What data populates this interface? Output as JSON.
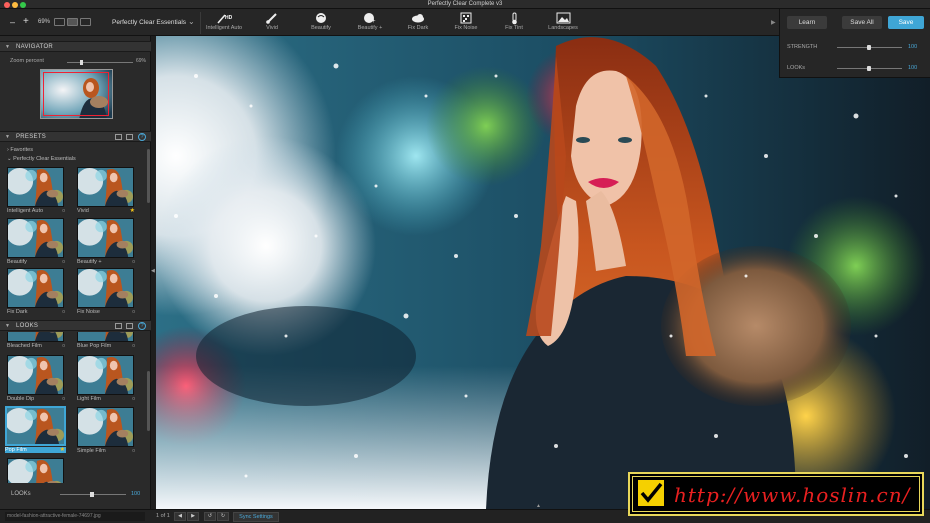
{
  "window": {
    "title": "Perfectly Clear Complete v3"
  },
  "toolbar": {
    "zoom_minus": "–",
    "zoom_plus": "+",
    "zoom_level": "69%",
    "preset_select": "Perfectly Clear Essentials",
    "tools": [
      {
        "label": "Intelligent Auto",
        "icon": "hd-wand-icon"
      },
      {
        "label": "Vivid",
        "icon": "brush-icon"
      },
      {
        "label": "Beautify",
        "icon": "face-icon"
      },
      {
        "label": "Beautify +",
        "icon": "face-plus-icon"
      },
      {
        "label": "Fix Dark",
        "icon": "cloud-icon"
      },
      {
        "label": "Fix Noise",
        "icon": "noise-icon"
      },
      {
        "label": "Fix Tint",
        "icon": "thermometer-icon"
      },
      {
        "label": "Landscapes",
        "icon": "landscape-icon"
      }
    ]
  },
  "right_panel": {
    "learn": "Learn",
    "save_all": "Save All",
    "save": "Save",
    "strength_label": "STRENGTH",
    "strength_value": "100",
    "looks_label": "LOOKs",
    "looks_value": "100"
  },
  "navigator": {
    "title": "NAVIGATOR",
    "zoom_label": "Zoom percent",
    "zoom_value": "69%"
  },
  "presets": {
    "title": "PRESETS",
    "help": "?",
    "favorites": "Favorites",
    "group": "Perfectly Clear Essentials",
    "items": [
      {
        "label": "Intelligent Auto",
        "mark": "o"
      },
      {
        "label": "Vivid",
        "mark": "★"
      },
      {
        "label": "Beautify",
        "mark": "o"
      },
      {
        "label": "Beautify +",
        "mark": "o"
      },
      {
        "label": "Fix Dark",
        "mark": "o"
      },
      {
        "label": "Fix Noise",
        "mark": "o"
      }
    ]
  },
  "looks": {
    "title": "LOOKS",
    "help": "?",
    "items": [
      {
        "label": "Bleached Film",
        "mark": "o"
      },
      {
        "label": "Blue Pop Film",
        "mark": "o"
      },
      {
        "label": "Double Dip",
        "mark": "o"
      },
      {
        "label": "Light Film",
        "mark": "o"
      },
      {
        "label": "Pop Film",
        "mark": "★"
      },
      {
        "label": "Simple Film",
        "mark": "o"
      }
    ],
    "bottom_label": "LOOKs",
    "bottom_value": "100"
  },
  "bottombar": {
    "filename": "model-fashion-attractive-female-74697.jpg",
    "page": "1 of 1",
    "sync": "Sync Settings"
  },
  "watermark": {
    "text": "http://www.hoslin.cn/"
  }
}
